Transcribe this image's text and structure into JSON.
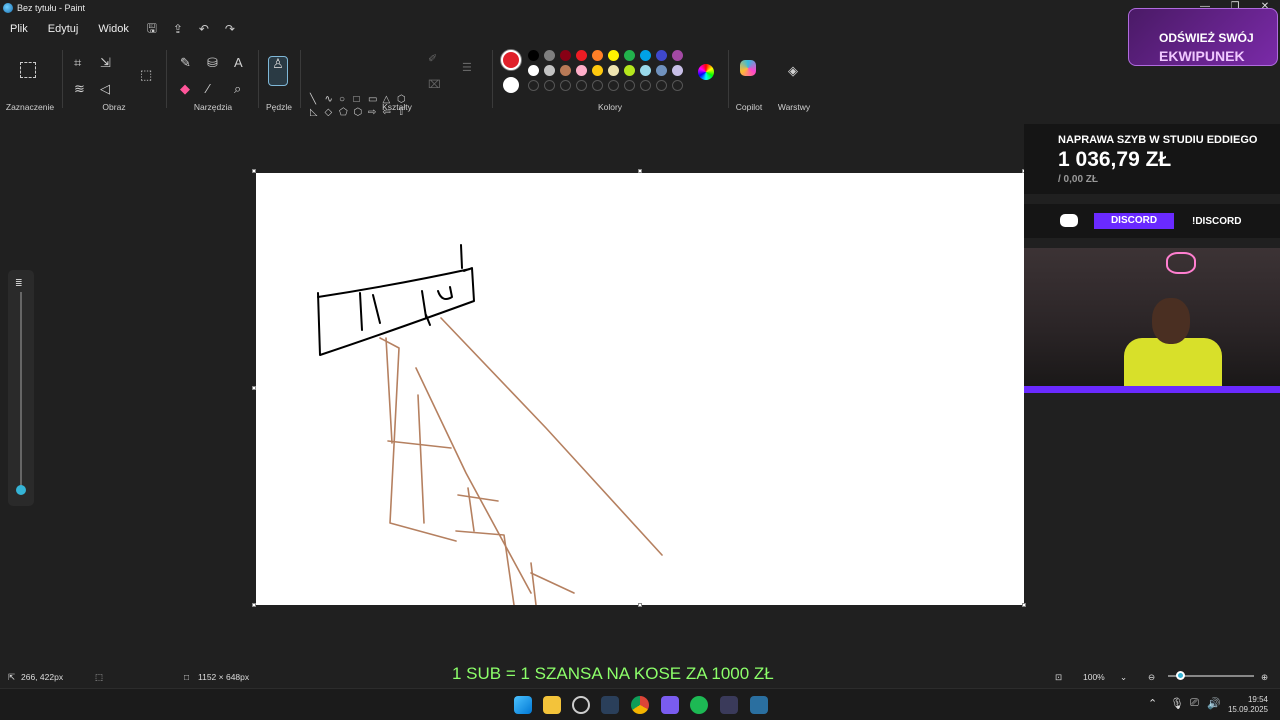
{
  "window": {
    "title": "Bez tytułu - Paint",
    "controls": [
      "—",
      "❐",
      "✕"
    ]
  },
  "menu": {
    "items": [
      "Plik",
      "Edytuj",
      "Widok"
    ]
  },
  "ribbon": {
    "groups": {
      "selection": "Zaznaczenie",
      "image": "Obraz",
      "tools": "Narzędzia",
      "brushes": "Pędzle",
      "shapes": "Kształty",
      "colors": "Kolory",
      "copilot": "Copilot",
      "layers": "Warstwy"
    },
    "shape_glyphs": [
      "╲",
      "∿",
      "○",
      "□",
      "▭",
      "△",
      "⬡",
      "◺",
      "◇",
      "⬠",
      "⬡",
      "⇨",
      "⇦",
      "⇧",
      "⇩",
      "✦",
      "☆",
      "✶",
      "▭",
      "○",
      "◯"
    ],
    "color_row1": [
      "#000000",
      "#7f7f7f",
      "#880015",
      "#ed1c24",
      "#ff7f27",
      "#fff200",
      "#22b14c",
      "#00a2e8",
      "#3f48cc",
      "#a349a4"
    ],
    "color_row2": [
      "#ffffff",
      "#c3c3c3",
      "#b97a57",
      "#ffaec9",
      "#ffc90e",
      "#efe4b0",
      "#b5e61d",
      "#99d9ea",
      "#7092be",
      "#c8bfe7"
    ],
    "current_color": "#e0202a",
    "secondary_color": "#ffffff"
  },
  "overlays": {
    "promo_line1": "ODŚWIEŻ SWÓJ",
    "promo_line2": "EKWIPUNEK",
    "goal_title": "NAPRAWA SZYB W STUDIU EDDIEGO",
    "goal_amount": "1 036,79 ZŁ",
    "goal_progress": "/ 0,00 ZŁ",
    "discord_button": "DISCORD",
    "discord_command": "!DISCORD",
    "banner": "1 SUB = 1 SZANSA NA KOSE ZA 1000 ZŁ"
  },
  "status": {
    "cursor_pos": "266, 422px",
    "canvas_size": "1152 × 648px",
    "zoom": "100%",
    "zoom_level": 0.1
  },
  "taskbar": {
    "time": "19:54",
    "date": "15.09.2025"
  }
}
